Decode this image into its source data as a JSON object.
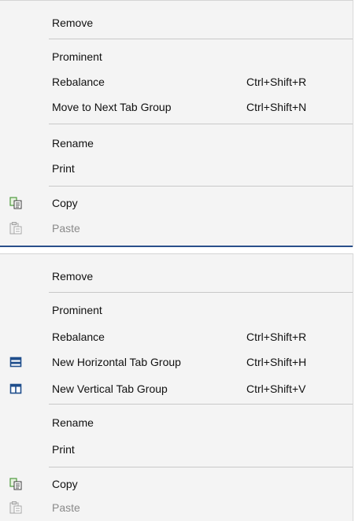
{
  "menus": [
    {
      "items": [
        {
          "label": "Remove"
        },
        {
          "label": "Prominent"
        },
        {
          "label": "Rebalance",
          "shortcut": "Ctrl+Shift+R"
        },
        {
          "label": "Move to Next Tab Group",
          "shortcut": "Ctrl+Shift+N"
        },
        {
          "label": "Rename"
        },
        {
          "label": "Print"
        },
        {
          "label": "Copy",
          "icon": "copy-icon"
        },
        {
          "label": "Paste",
          "icon": "paste-icon",
          "disabled": true
        }
      ]
    },
    {
      "items": [
        {
          "label": "Remove"
        },
        {
          "label": "Prominent"
        },
        {
          "label": "Rebalance",
          "shortcut": "Ctrl+Shift+R"
        },
        {
          "label": "New Horizontal Tab Group",
          "shortcut": "Ctrl+Shift+H",
          "icon": "horizontal-tab-group-icon"
        },
        {
          "label": "New Vertical Tab Group",
          "shortcut": "Ctrl+Shift+V",
          "icon": "vertical-tab-group-icon"
        },
        {
          "label": "Rename"
        },
        {
          "label": "Print"
        },
        {
          "label": "Copy",
          "icon": "copy-icon"
        },
        {
          "label": "Paste",
          "icon": "paste-icon",
          "disabled": true
        }
      ]
    }
  ],
  "colors": {
    "menu_background": "#f4f4f4",
    "separator": "#c8c8c8",
    "disabled_text": "#8a8a8a",
    "icon_blue": "#1f4e8c",
    "copy_icon_green": "#4f9a3f"
  }
}
